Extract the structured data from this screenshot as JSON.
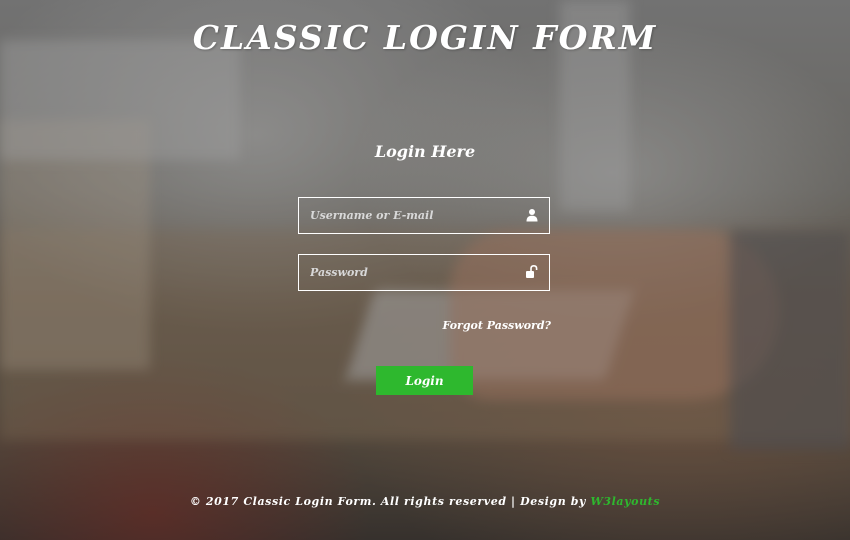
{
  "header": {
    "title": "CLASSIC LOGIN FORM"
  },
  "form": {
    "heading": "Login Here",
    "username": {
      "placeholder": "Username or E-mail",
      "value": "",
      "icon": "user-icon"
    },
    "password": {
      "placeholder": "Password",
      "value": "",
      "icon": "unlock-icon"
    },
    "forgot_label": "Forgot Password?",
    "login_label": "Login"
  },
  "footer": {
    "text": "© 2017 Classic Login Form. All rights reserved | Design by ",
    "link_label": "W3layouts"
  },
  "colors": {
    "accent": "#2eb82e",
    "text": "#ffffff"
  }
}
